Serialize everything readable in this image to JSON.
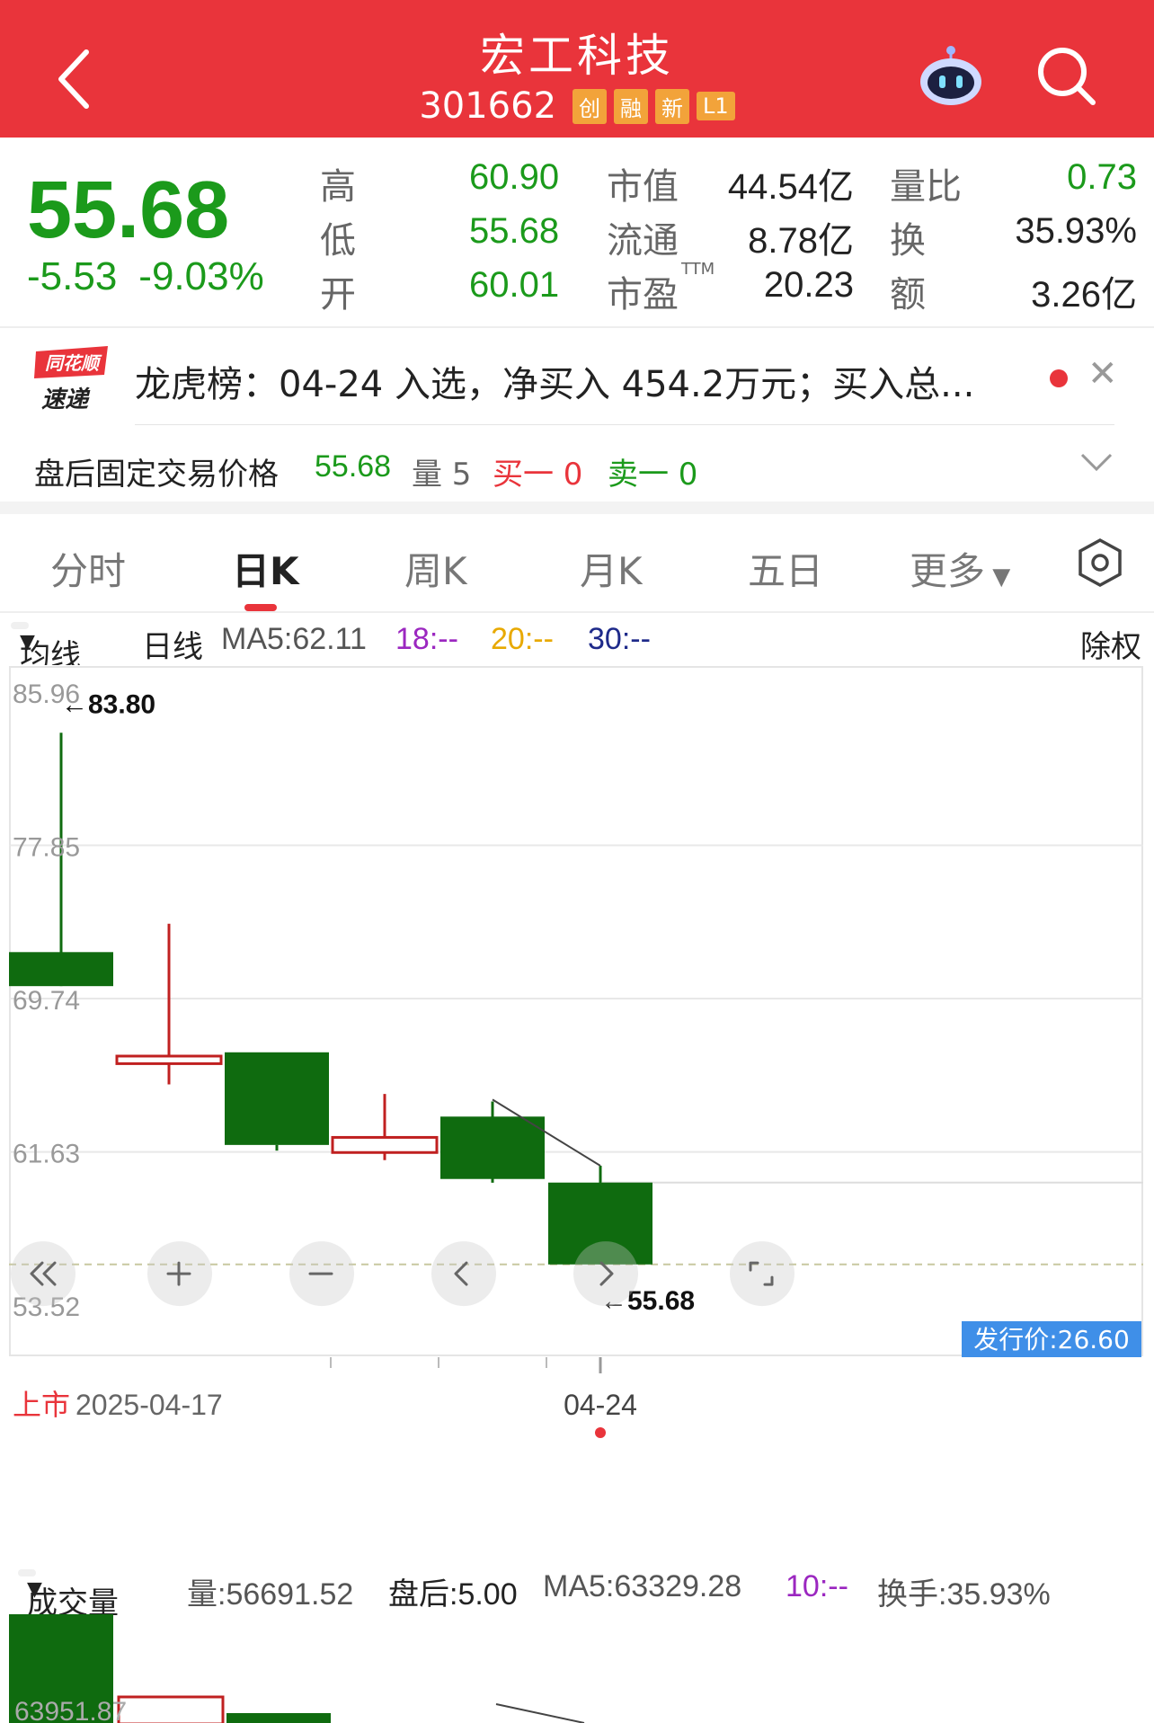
{
  "header": {
    "title": "宏工科技",
    "code": "301662",
    "tags": [
      "创",
      "融",
      "新",
      "L1"
    ]
  },
  "quote": {
    "price": "55.68",
    "change": "-5.53",
    "change_pct": "-9.03%",
    "high_label": "高",
    "high": "60.90",
    "low_label": "低",
    "low": "55.68",
    "open_label": "开",
    "open": "60.01",
    "mktcap_label": "市值",
    "mktcap": "44.54亿",
    "float_label": "流通",
    "float": "8.78亿",
    "pe_label": "市盈",
    "pe_sup": "TTM",
    "pe": "20.23",
    "volratio_label": "量比",
    "volratio": "0.73",
    "turnover_label": "换",
    "turnover": "35.93%",
    "amount_label": "额",
    "amount": "3.26亿"
  },
  "news": {
    "logo_top": "同花顺",
    "logo_bottom": "速递",
    "text": "龙虎榜：04-24 入选，净买入 454.2万元；买入总..."
  },
  "after_hours": {
    "label": "盘后固定交易价格",
    "price": "55.68",
    "vol_label": "量 5",
    "buy1": "买一 0",
    "sell1": "卖一 0"
  },
  "tabs": [
    "分时",
    "日K",
    "周K",
    "月K",
    "五日",
    "更多"
  ],
  "ma_bar": {
    "dropdown": "均线",
    "period": "日线",
    "ma5": "MA5:62.11",
    "ma18": "18:--",
    "ma20": "20:--",
    "ma30": "30:--",
    "adjust": "除权"
  },
  "chart_data": {
    "type": "candlestick",
    "y_ticks": [
      "85.96",
      "77.85",
      "69.74",
      "61.63",
      "53.52"
    ],
    "ylim": [
      52.2,
      87.0
    ],
    "candles": [
      {
        "open": 72.2,
        "close": 70.4,
        "high": 83.8,
        "low": 70.4
      },
      {
        "open": 66.3,
        "close": 66.7,
        "high": 73.7,
        "low": 65.2
      },
      {
        "open": 66.9,
        "close": 62.0,
        "high": 62.0,
        "low": 61.7
      },
      {
        "open": 61.6,
        "close": 62.4,
        "high": 64.7,
        "low": 61.2
      },
      {
        "open": 63.5,
        "close": 60.2,
        "high": 64.3,
        "low": 60.0
      },
      {
        "open": 60.01,
        "close": 55.68,
        "high": 60.9,
        "low": 55.68
      }
    ],
    "max_label": "←83.80",
    "min_label": "←55.68",
    "issue_price_label": "发行价:26.60",
    "listing_prefix": "上市",
    "listing_date": "2025-04-17",
    "marked_date": "04-24",
    "colors": {
      "down": "#0f6b0f",
      "up": "#c02020",
      "ma": "#444444"
    }
  },
  "volume_bar": {
    "dropdown": "成交量",
    "vol": "量:56691.52",
    "after": "盘后:5.00",
    "ma5": "MA5:63329.28",
    "ma10": "10:--",
    "turnover": "换手:35.93%",
    "axis_label": "63951.87"
  }
}
